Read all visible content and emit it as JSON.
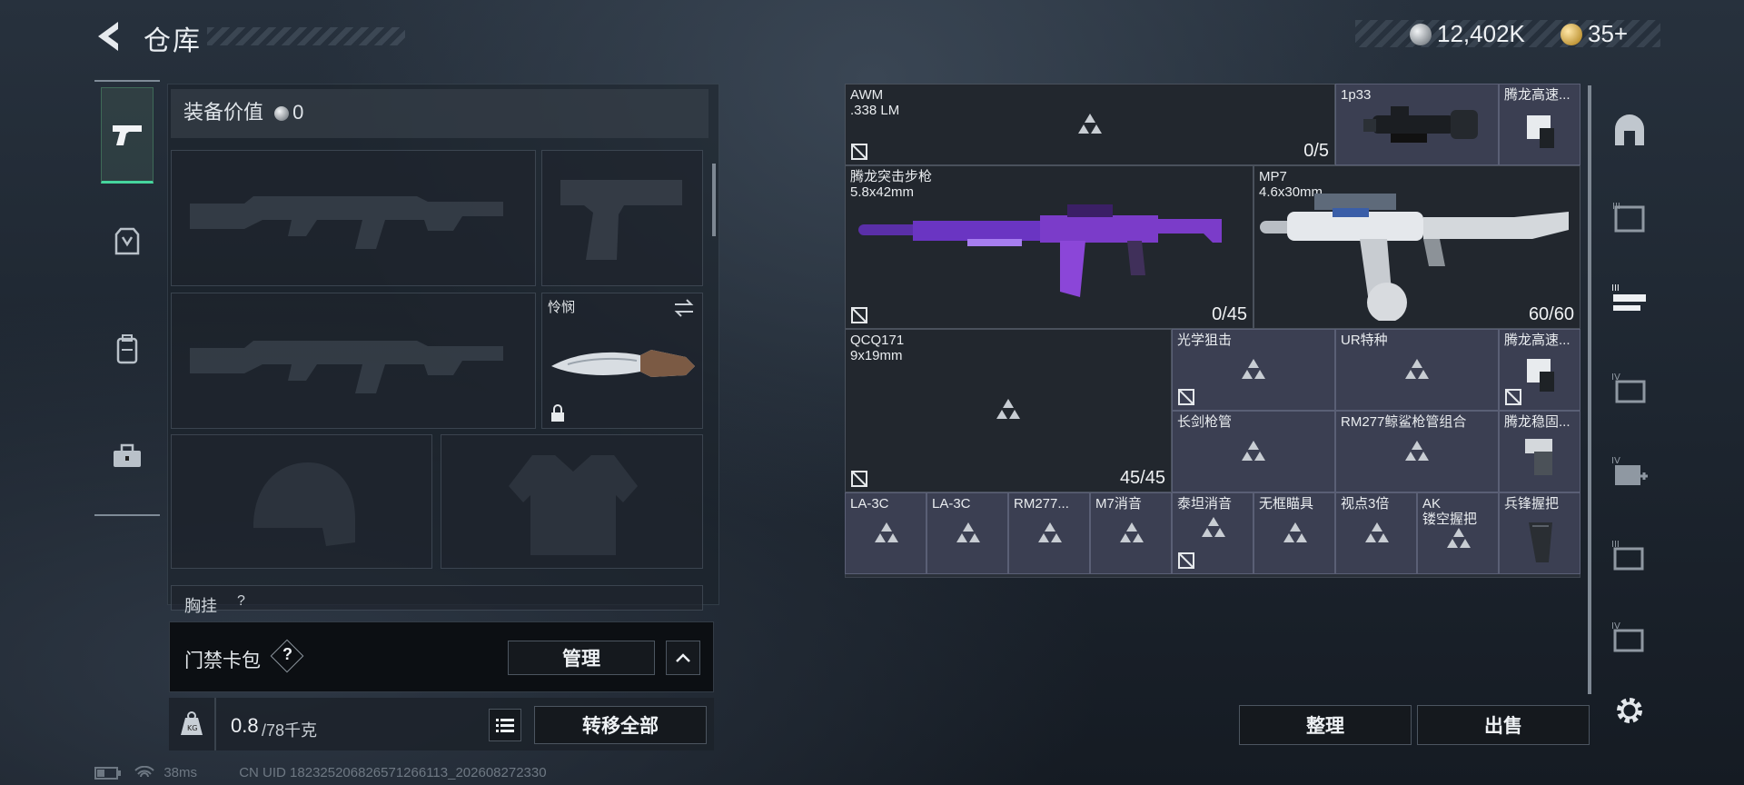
{
  "header": {
    "title": "仓库",
    "currency_silver": "12,402K",
    "currency_gold": "35+"
  },
  "equipment": {
    "value_label": "装备价值",
    "value": "0",
    "melee_name": "怜悯",
    "chest_rig_label": "胸挂",
    "chest_rig_help": "?"
  },
  "card_bag": {
    "label": "门禁卡包",
    "help": "?",
    "manage_label": "管理"
  },
  "weight": {
    "current": "0.8",
    "max": "/78千克",
    "transfer_all_label": "转移全部"
  },
  "stash": {
    "items": [
      {
        "name": "AWM",
        "sub": ".338 LM",
        "count": "0/5"
      },
      {
        "name": "1p33",
        "sub": "",
        "count": ""
      },
      {
        "name": "腾龙高速...",
        "sub": "",
        "count": ""
      },
      {
        "name": "腾龙突击步枪",
        "sub": "5.8x42mm",
        "count": "0/45"
      },
      {
        "name": "MP7",
        "sub": "4.6x30mm",
        "count": "60/60"
      },
      {
        "name": "QCQ171",
        "sub": "9x19mm",
        "count": "45/45"
      },
      {
        "name": "光学狙击",
        "sub": "",
        "count": ""
      },
      {
        "name": "UR特种",
        "sub": "",
        "count": ""
      },
      {
        "name": "腾龙高速...",
        "sub": "",
        "count": ""
      },
      {
        "name": "长剑枪管",
        "sub": "",
        "count": ""
      },
      {
        "name": "RM277鲸鲨枪管组合",
        "sub": "",
        "count": ""
      },
      {
        "name": "腾龙稳固...",
        "sub": "",
        "count": ""
      },
      {
        "name": "LA-3C",
        "sub": "",
        "count": ""
      },
      {
        "name": "LA-3C",
        "sub": "",
        "count": ""
      },
      {
        "name": "RM277...",
        "sub": "",
        "count": ""
      },
      {
        "name": "M7消音",
        "sub": "",
        "count": ""
      },
      {
        "name": "泰坦消音",
        "sub": "",
        "count": ""
      },
      {
        "name": "无框瞄具",
        "sub": "",
        "count": ""
      },
      {
        "name": "视点3倍",
        "sub": "",
        "count": ""
      },
      {
        "name": "AK",
        "sub": "镂空握把",
        "count": ""
      },
      {
        "name": "兵锋握把",
        "sub": "",
        "count": ""
      }
    ],
    "sort_label": "整理",
    "sell_label": "出售"
  },
  "status": {
    "ping": "38ms",
    "uid": "CN UID 1823252068265712661​13_202608272330"
  },
  "icons": [
    "back-arrow-icon",
    "silver-coin-icon",
    "gold-coin-icon",
    "pistol-icon",
    "armor-icon",
    "backpack-icon",
    "toolbox-icon",
    "weight-icon",
    "list-icon",
    "chevron-up-icon",
    "settings-icon",
    "battery-icon",
    "wifi-icon"
  ],
  "colors": {
    "active_tab": "#46d59d",
    "item_bg": "#3b3f52",
    "weapon_purple": "#7b3cc9"
  }
}
